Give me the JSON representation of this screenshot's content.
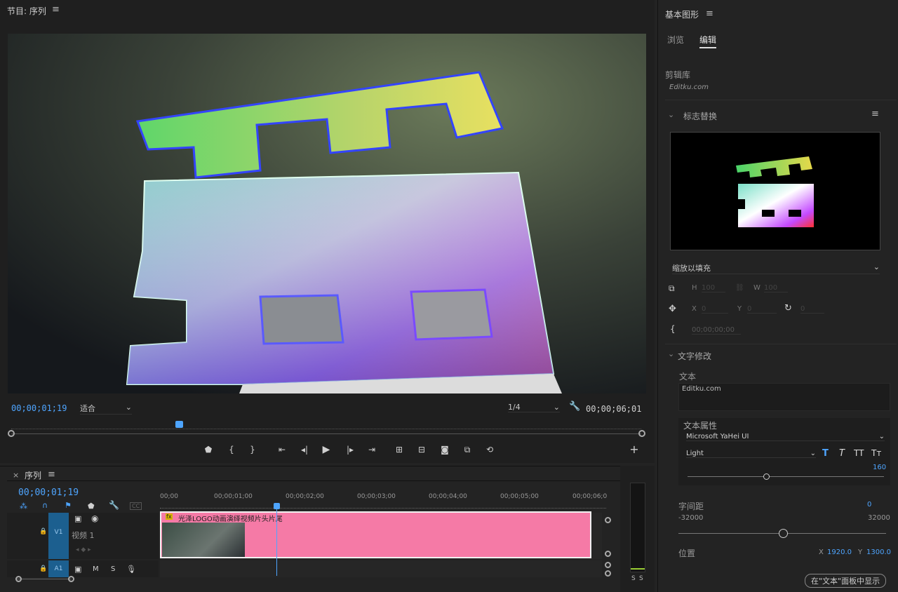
{
  "program": {
    "title": "节目: 序列",
    "timecode": "00;00;01;19",
    "fit": "适合",
    "resolution": "1/4",
    "duration": "00;00;06;01"
  },
  "timeline": {
    "title": "序列",
    "timecode": "00;00;01;19",
    "ruler": [
      "00;00",
      "00;00;01;00",
      "00;00;02;00",
      "00;00;03;00",
      "00;00;04;00",
      "00;00;05;00",
      "00;00;06;0"
    ],
    "v1": "V1",
    "video_track": "视频 1",
    "a1": "A1",
    "m": "M",
    "s": "S",
    "clip_label": "光泽LOGO动画演绎视频片头片尾",
    "fx": "fx",
    "cc": "CC"
  },
  "meter": {
    "s1": "S",
    "s2": "S"
  },
  "egp": {
    "title": "基本图形",
    "tabs": [
      "浏览",
      "编辑"
    ],
    "library_label": "剪辑库",
    "library_value": "Editku.com",
    "section_logo": "标志替换",
    "scale_mode": "缩放以填充",
    "h": "H",
    "w": "W",
    "x": "X",
    "y": "Y",
    "h_val": "100",
    "w_val": "100",
    "x_val": "0",
    "y_val": "0",
    "rot_val": "0",
    "time": "00;00;00;00",
    "section_text": "文字修改",
    "text_label": "文本",
    "text_value": "Editku.com",
    "text_props": "文本属性",
    "font": "Microsoft YaHei UI",
    "weight": "Light",
    "size": "160",
    "style_btns": [
      "T",
      "T",
      "TT",
      "Tт"
    ],
    "tracking_label": "字间距",
    "tracking_value": "0",
    "tracking_min": "-32000",
    "tracking_max": "32000",
    "position_label": "位置",
    "pos_x_label": "X",
    "pos_x": "1920.0",
    "pos_y_label": "Y",
    "pos_y": "1300.0",
    "footer_btn": "在\"文本\"面板中显示"
  },
  "colors": {
    "accent": "#4ea5ff",
    "clip": "#f57aa6",
    "track_blue": "#1c5f8f"
  }
}
